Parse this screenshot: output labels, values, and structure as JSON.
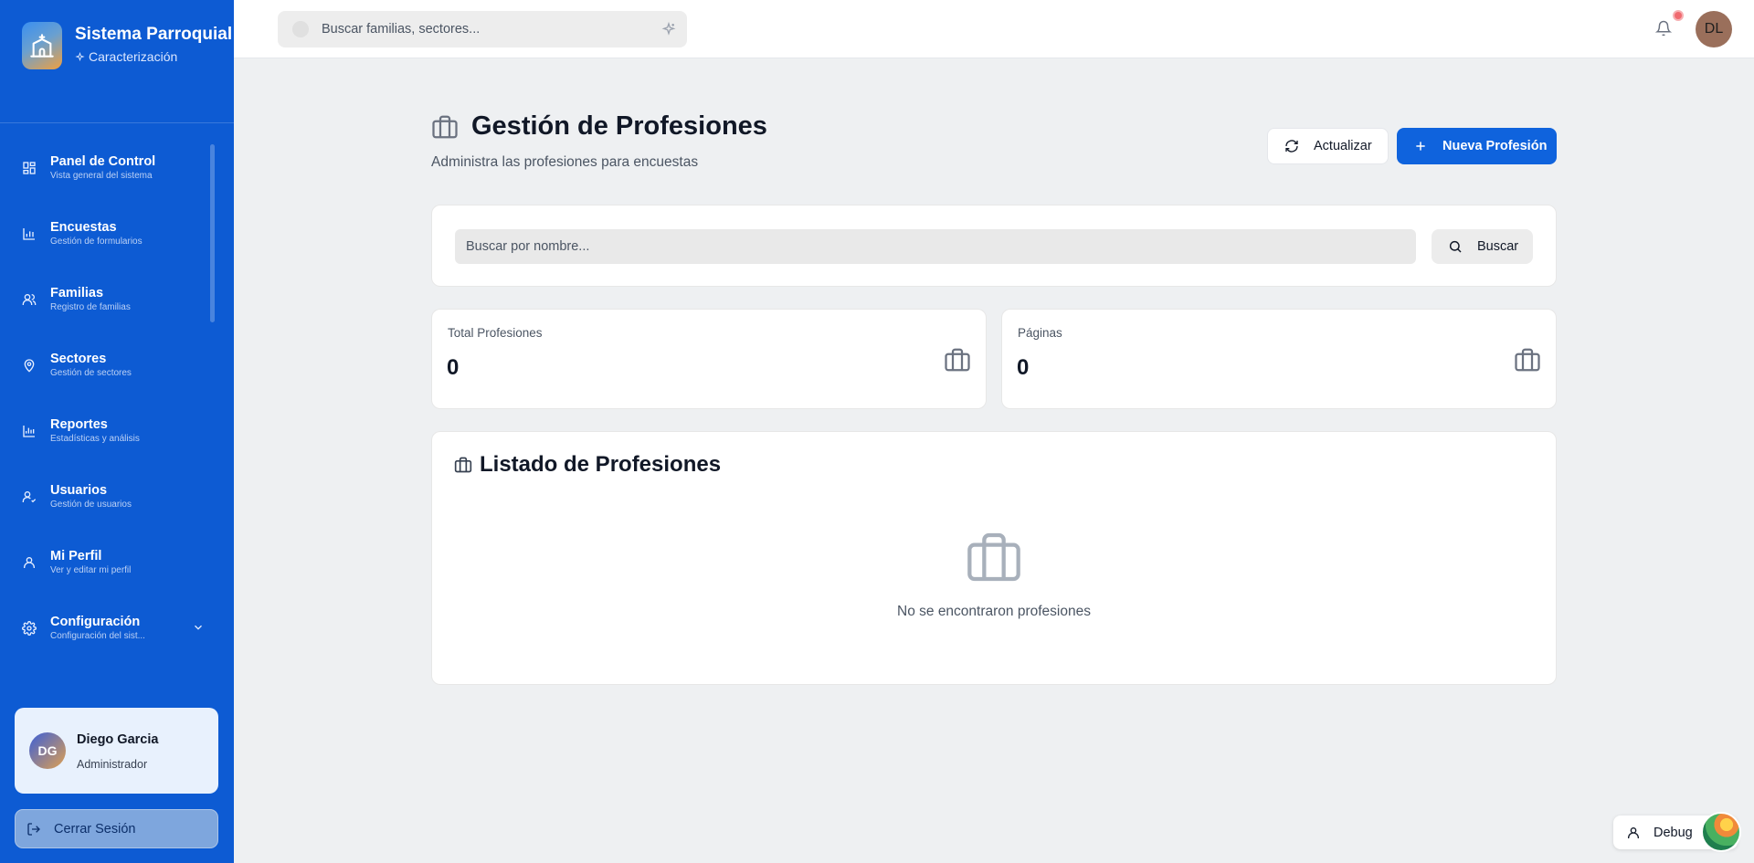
{
  "app": {
    "title": "Sistema Parroquial",
    "subtitle": "Caracterización"
  },
  "sidebar": {
    "items": [
      {
        "label": "Panel de Control",
        "sub": "Vista general del sistema",
        "icon": "grid-icon"
      },
      {
        "label": "Encuestas",
        "sub": "Gestión de formularios",
        "icon": "bar-chart-icon"
      },
      {
        "label": "Familias",
        "sub": "Registro de familias",
        "icon": "users-icon"
      },
      {
        "label": "Sectores",
        "sub": "Gestión de sectores",
        "icon": "map-pin-icon"
      },
      {
        "label": "Reportes",
        "sub": "Estadísticas y análisis",
        "icon": "chart-icon"
      },
      {
        "label": "Usuarios",
        "sub": "Gestión de usuarios",
        "icon": "user-check-icon"
      },
      {
        "label": "Mi Perfil",
        "sub": "Ver y editar mi perfil",
        "icon": "user-icon"
      },
      {
        "label": "Configuración",
        "sub": "Configuración del sist...",
        "icon": "gear-icon"
      }
    ],
    "user": {
      "initials": "DG",
      "name": "Diego Garcia",
      "role": "Administrador"
    },
    "logout_label": "Cerrar Sesión"
  },
  "topbar": {
    "search_placeholder": "Buscar familias, sectores...",
    "avatar_initials": "DL"
  },
  "page": {
    "title": "Gestión de Profesiones",
    "subtitle": "Administra las profesiones para encuestas",
    "refresh_label": "Actualizar",
    "new_label": "Nueva Profesión",
    "search_placeholder": "Buscar por nombre...",
    "search_button": "Buscar"
  },
  "stats": [
    {
      "label": "Total Profesiones",
      "value": "0"
    },
    {
      "label": "Páginas",
      "value": "0"
    }
  ],
  "list": {
    "title": "Listado de Profesiones",
    "empty_text": "No se encontraron profesiones"
  },
  "debug": {
    "label": "Debug"
  },
  "colors": {
    "sidebar_bg": "#0d5bd3",
    "primary": "#0f63dd",
    "page_bg": "#eef0f2"
  }
}
